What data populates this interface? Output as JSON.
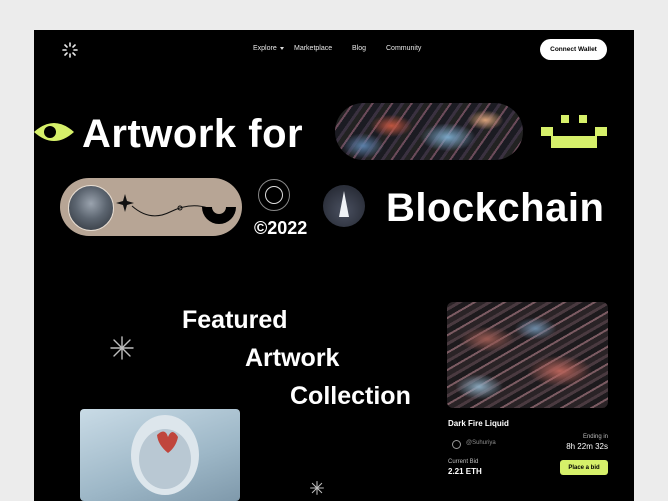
{
  "nav": {
    "items": [
      "Explore",
      "Marketplace",
      "Blog",
      "Community"
    ],
    "connect_label": "Connect Wallet"
  },
  "hero": {
    "line1": "Artwork for",
    "line2": "Blockchain",
    "year": "©2022"
  },
  "featured": {
    "line1": "Featured",
    "line2": "Artwork",
    "line3": "Collection"
  },
  "card": {
    "title": "Dark Fire Liquid",
    "creator": "@Suhuriya",
    "ending_label": "Ending in",
    "ending_time": "8h 22m 32s",
    "bid_label": "Current Bid",
    "bid_value": "2.21 ETH",
    "bid_button": "Place a bid"
  },
  "colors": {
    "accent": "#d6f06a",
    "page_bg": "#000000",
    "outer_bg": "#ececec",
    "pill_beige": "#b7a595"
  },
  "icons": [
    "logo-icon",
    "chevron-down-icon",
    "eye-icon",
    "pixel-face-icon",
    "sparkle-icon",
    "coin-icon",
    "asterisk-icon",
    "creator-icon"
  ]
}
